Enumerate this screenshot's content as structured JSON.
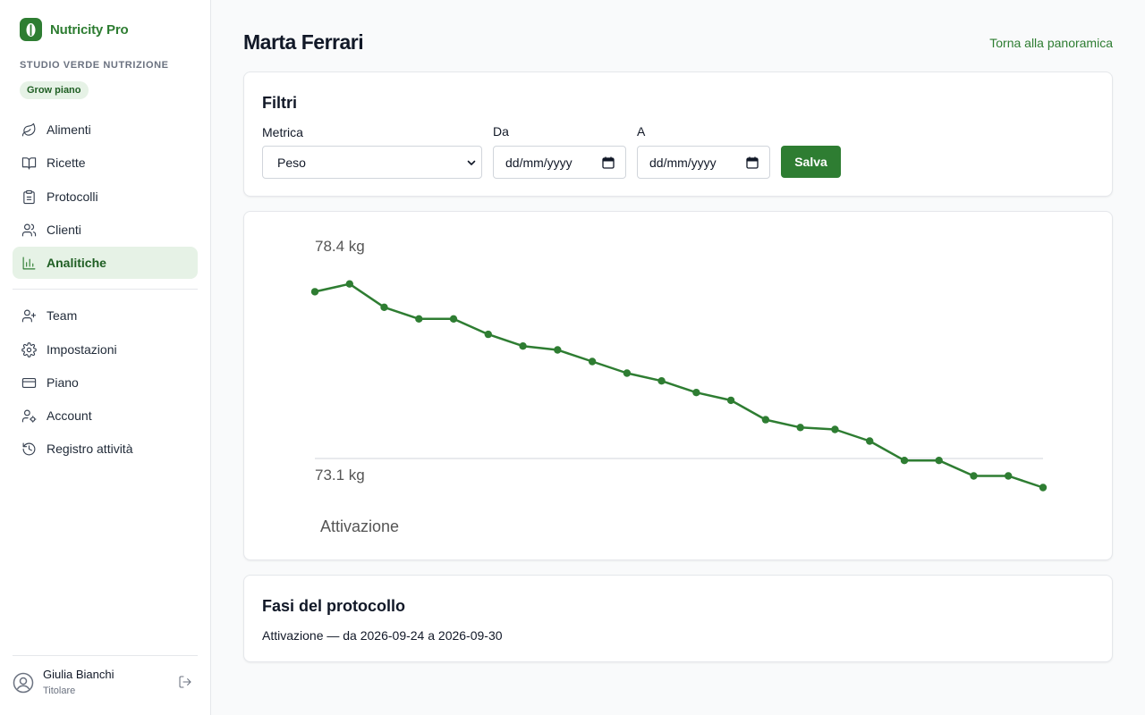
{
  "app": {
    "name": "Nutricity Pro"
  },
  "sidebar": {
    "org_name": "STUDIO VERDE NUTRIZIONE",
    "plan_badge": "Grow piano",
    "items": [
      {
        "label": "Alimenti",
        "icon": "leaf-icon",
        "active": false
      },
      {
        "label": "Ricette",
        "icon": "book-icon",
        "active": false
      },
      {
        "label": "Protocolli",
        "icon": "clipboard-icon",
        "active": false
      },
      {
        "label": "Clienti",
        "icon": "users-icon",
        "active": false
      },
      {
        "label": "Analitiche",
        "icon": "bar-chart-icon",
        "active": true
      },
      {
        "label": "Team",
        "icon": "user-plus-icon",
        "active": false
      },
      {
        "label": "Impostazioni",
        "icon": "gear-icon",
        "active": false
      },
      {
        "label": "Piano",
        "icon": "credit-card-icon",
        "active": false
      },
      {
        "label": "Account",
        "icon": "user-cog-icon",
        "active": false
      },
      {
        "label": "Registro attività",
        "icon": "history-icon",
        "active": false
      }
    ],
    "user": {
      "name": "Giulia Bianchi",
      "role": "Titolare"
    }
  },
  "header": {
    "title": "Marta Ferrari",
    "back_link": "Torna alla panoramica"
  },
  "filters": {
    "title": "Filtri",
    "metric_label": "Metrica",
    "metric_value": "Peso",
    "from_label": "Da",
    "from_value": "dd/mm/yyyy",
    "to_label": "A",
    "to_value": "dd/mm/yyyy",
    "save_label": "Salva"
  },
  "chart_data": {
    "type": "line",
    "max_label": "78.4 kg",
    "min_label": "73.1 kg",
    "phase_label": "Attivazione",
    "ylim": [
      73.1,
      78.4
    ],
    "color": "#2e7d32",
    "values": [
      77.4,
      77.6,
      77.0,
      76.7,
      76.7,
      76.3,
      76.0,
      75.9,
      75.6,
      75.3,
      75.1,
      74.8,
      74.6,
      74.1,
      73.9,
      73.85,
      73.55,
      73.05,
      73.05,
      72.65,
      72.65,
      72.35
    ]
  },
  "phases": {
    "title": "Fasi del protocollo",
    "line": "Attivazione — da 2026-09-24 a 2026-09-30"
  },
  "colors": {
    "accent": "#2e7d32",
    "accent_light": "#e6f2e6"
  }
}
